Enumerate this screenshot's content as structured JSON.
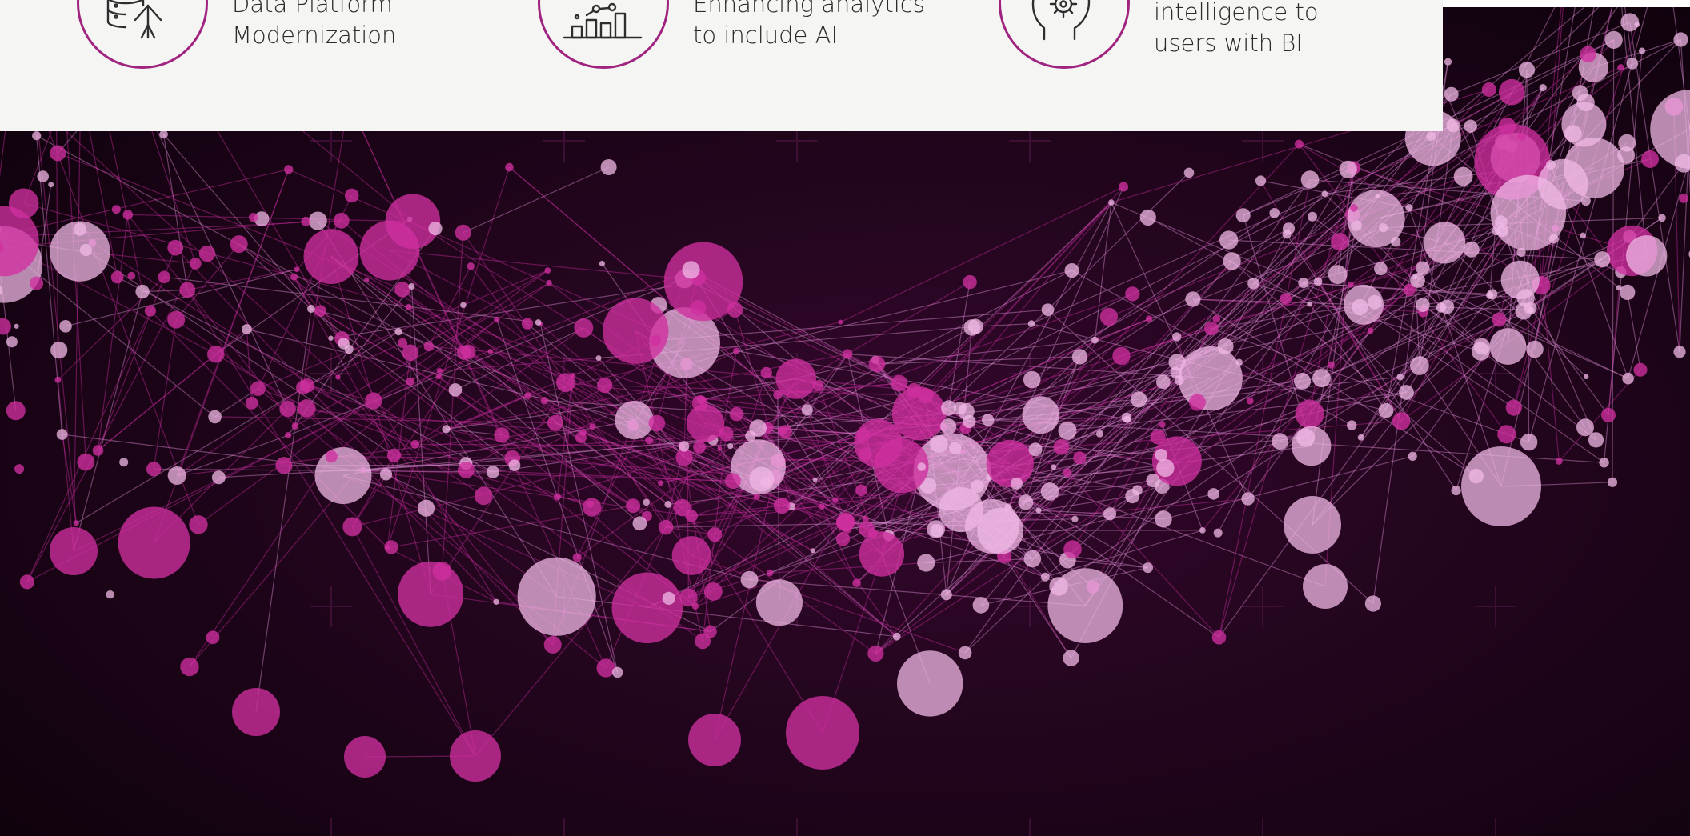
{
  "colors": {
    "accent": "#a0237f",
    "card_background": "#f5f5f3",
    "hero_background": "#140311",
    "node_magenta": "#d0309f",
    "node_light": "#f0b8e6"
  },
  "features": [
    {
      "icon": "database-upgrade-icon",
      "lines": [
        "Data Platform",
        "Modernization"
      ]
    },
    {
      "icon": "analytics-chart-icon",
      "lines": [
        "Enhancing analytics",
        "to include AI"
      ]
    },
    {
      "icon": "head-gear-icon",
      "lines": [
        "intelligence to",
        "users with BI"
      ]
    }
  ],
  "hero": {
    "image": "network-nodes-graphic"
  }
}
